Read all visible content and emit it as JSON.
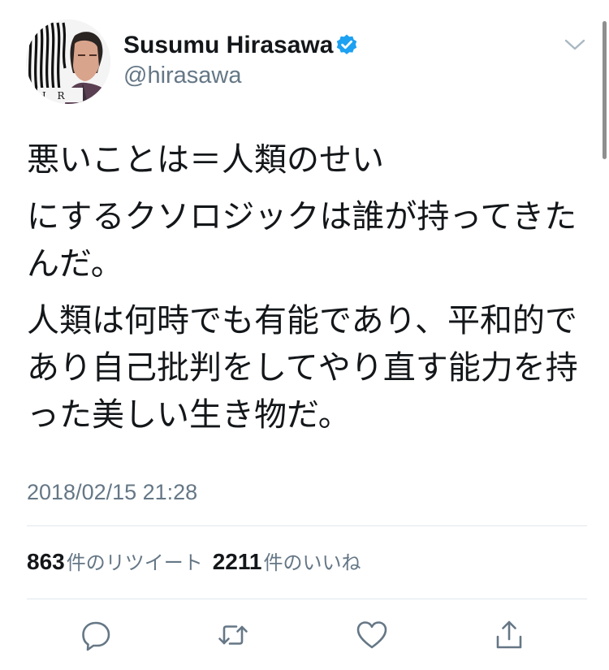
{
  "user": {
    "display_name": "Susumu Hirasawa",
    "handle": "@hirasawa",
    "verified_icon": "verified-badge-icon",
    "avatar_text": "I R"
  },
  "tweet": {
    "paragraphs": [
      "悪いことは＝人類のせい",
      "にするクソロジックは誰が持ってきたんだ。",
      "人類は何時でも有能であり、平和的であり自己批判をしてやり直す能力を持った美しい生き物だ。"
    ],
    "timestamp": "2018/02/15 21:28"
  },
  "stats": {
    "retweets_count": "863",
    "retweets_label": "件のリツイート",
    "likes_count": "2211",
    "likes_label": "件のいいね"
  },
  "actions": [
    {
      "name": "reply",
      "icon": "reply-icon"
    },
    {
      "name": "retweet",
      "icon": "retweet-icon"
    },
    {
      "name": "like",
      "icon": "heart-icon"
    },
    {
      "name": "share",
      "icon": "share-icon"
    }
  ],
  "colors": {
    "primary_text": "#14171a",
    "secondary_text": "#657786",
    "icon_gray": "#657786",
    "verified_blue": "#1da1f2",
    "divider": "#e1e8ed"
  }
}
